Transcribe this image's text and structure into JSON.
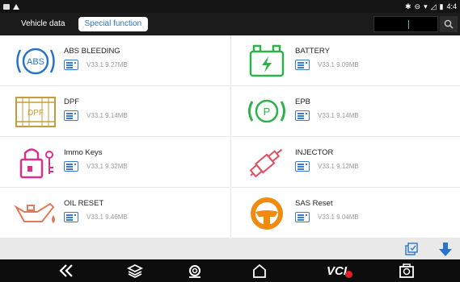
{
  "statusbar": {
    "time": "4:4"
  },
  "tabs": [
    {
      "label": "Vehicle data",
      "active": false
    },
    {
      "label": "Special function",
      "active": true
    }
  ],
  "functions": [
    {
      "title": "ABS BLEEDING",
      "version": "V33.1",
      "size": "9.27MB",
      "icon": "abs-icon",
      "color": "#2a74c8"
    },
    {
      "title": "BATTERY",
      "version": "V33.1",
      "size": "9.09MB",
      "icon": "battery-icon",
      "color": "#2fb24a"
    },
    {
      "title": "DPF",
      "version": "V33.1",
      "size": "9.14MB",
      "icon": "dpf-icon",
      "color": "#c89a3a"
    },
    {
      "title": "EPB",
      "version": "V33.1",
      "size": "9.14MB",
      "icon": "epb-icon",
      "color": "#2fb24a"
    },
    {
      "title": "Immo Keys",
      "version": "V33.1",
      "size": "9.32MB",
      "icon": "immo-keys-icon",
      "color": "#d9308c"
    },
    {
      "title": "INJECTOR",
      "version": "V33.1",
      "size": "9.12MB",
      "icon": "injector-icon",
      "color": "#e05060"
    },
    {
      "title": "OIL RESET",
      "version": "V33.1",
      "size": "9.46MB",
      "icon": "oil-reset-icon",
      "color": "#e07a5a"
    },
    {
      "title": "SAS Reset",
      "version": "V33.1",
      "size": "9.04MB",
      "icon": "steering-wheel-icon",
      "color": "#f08a10"
    }
  ],
  "abs_icon_text": "ABS",
  "dpf_icon_text": "DPF",
  "epb_icon_text": "P",
  "nav": {
    "vci_label": "VCI"
  },
  "colors": {
    "accent": "#2a74c8",
    "topbar": "#1b1b1b"
  }
}
